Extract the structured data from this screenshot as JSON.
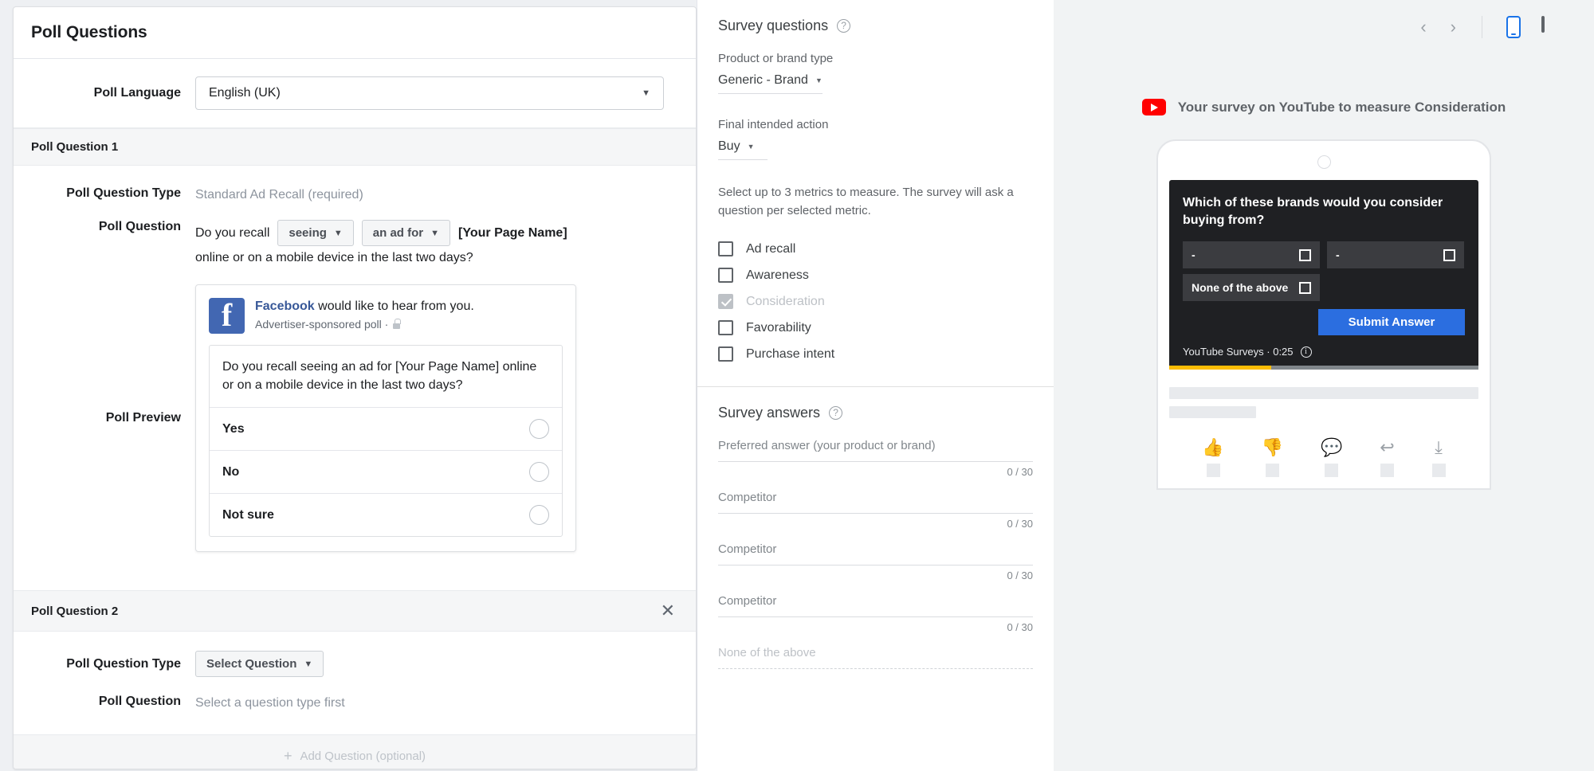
{
  "left_panel": {
    "card_title": "Poll Questions",
    "language_label": "Poll Language",
    "language_value": "English (UK)",
    "question1": {
      "section_title": "Poll Question 1",
      "type_label": "Poll Question Type",
      "type_value": "Standard Ad Recall (required)",
      "question_label": "Poll Question",
      "question_prefix": "Do you recall",
      "verb_select": "seeing",
      "object_select": "an ad for",
      "page_token": "[Your Page Name]",
      "question_suffix": "online or on a mobile device in the last two days?",
      "preview_label": "Poll Preview",
      "preview": {
        "brand": "Facebook",
        "headline_rest": " would like to hear from you.",
        "subtitle": "Advertiser-sponsored poll ·",
        "question": "Do you recall seeing an ad for [Your Page Name] online or on a mobile device in the last two days?",
        "options": [
          "Yes",
          "No",
          "Not sure"
        ]
      }
    },
    "question2": {
      "section_title": "Poll Question 2",
      "close_label": "✕",
      "type_label": "Poll Question Type",
      "type_select": "Select Question",
      "question_label": "Poll Question",
      "question_placeholder": "Select a question type first"
    },
    "add_question_label": "Add Question (optional)",
    "add_question_plus": "+"
  },
  "mid_panel": {
    "survey_questions": {
      "heading": "Survey questions",
      "product_type_label": "Product or brand type",
      "product_type_value": "Generic - Brand",
      "final_action_label": "Final intended action",
      "final_action_value": "Buy",
      "metrics_help": "Select up to 3 metrics to measure. The survey will ask a question per selected metric.",
      "metrics": [
        {
          "label": "Ad recall",
          "checked": false,
          "disabled": false
        },
        {
          "label": "Awareness",
          "checked": false,
          "disabled": false
        },
        {
          "label": "Consideration",
          "checked": true,
          "disabled": true
        },
        {
          "label": "Favorability",
          "checked": false,
          "disabled": false
        },
        {
          "label": "Purchase intent",
          "checked": false,
          "disabled": false
        }
      ]
    },
    "survey_answers": {
      "heading": "Survey answers",
      "fields": [
        {
          "label": "Preferred answer (your product or brand)",
          "value": "",
          "counter": "0 / 30"
        },
        {
          "label": "Competitor",
          "value": "",
          "counter": "0 / 30"
        },
        {
          "label": "Competitor",
          "value": "",
          "counter": "0 / 30"
        },
        {
          "label": "Competitor",
          "value": "",
          "counter": "0 / 30"
        }
      ],
      "none_label": "None of the above"
    }
  },
  "right_panel": {
    "toolbar": {
      "prev_label": "‹",
      "next_label": "›",
      "mobile_icon": "mobile-device-icon",
      "desktop_icon": "desktop-device-icon",
      "active_device": "mobile"
    },
    "preview_heading": "Your survey on YouTube to measure Consideration",
    "player": {
      "question": "Which of these brands would you consider buying from?",
      "options": [
        "-",
        "-",
        "None of the above"
      ],
      "submit_label": "Submit Answer",
      "meta": "YouTube Surveys · 0:25",
      "progress_percent": 33
    },
    "actions": [
      {
        "icon": "thumbs-up-icon",
        "glyph": "👍"
      },
      {
        "icon": "thumbs-down-icon",
        "glyph": "👎"
      },
      {
        "icon": "comment-icon",
        "glyph": "💬"
      },
      {
        "icon": "share-icon",
        "glyph": "↰"
      },
      {
        "icon": "download-icon",
        "glyph": "⤓"
      }
    ]
  },
  "colors": {
    "fb_blue": "#4267b2",
    "fb_link": "#385898",
    "google_blue": "#1a73e8",
    "youtube_red": "#ff0000",
    "submit_blue": "#2b6ee0",
    "progress_yellow": "#fbbc04"
  }
}
